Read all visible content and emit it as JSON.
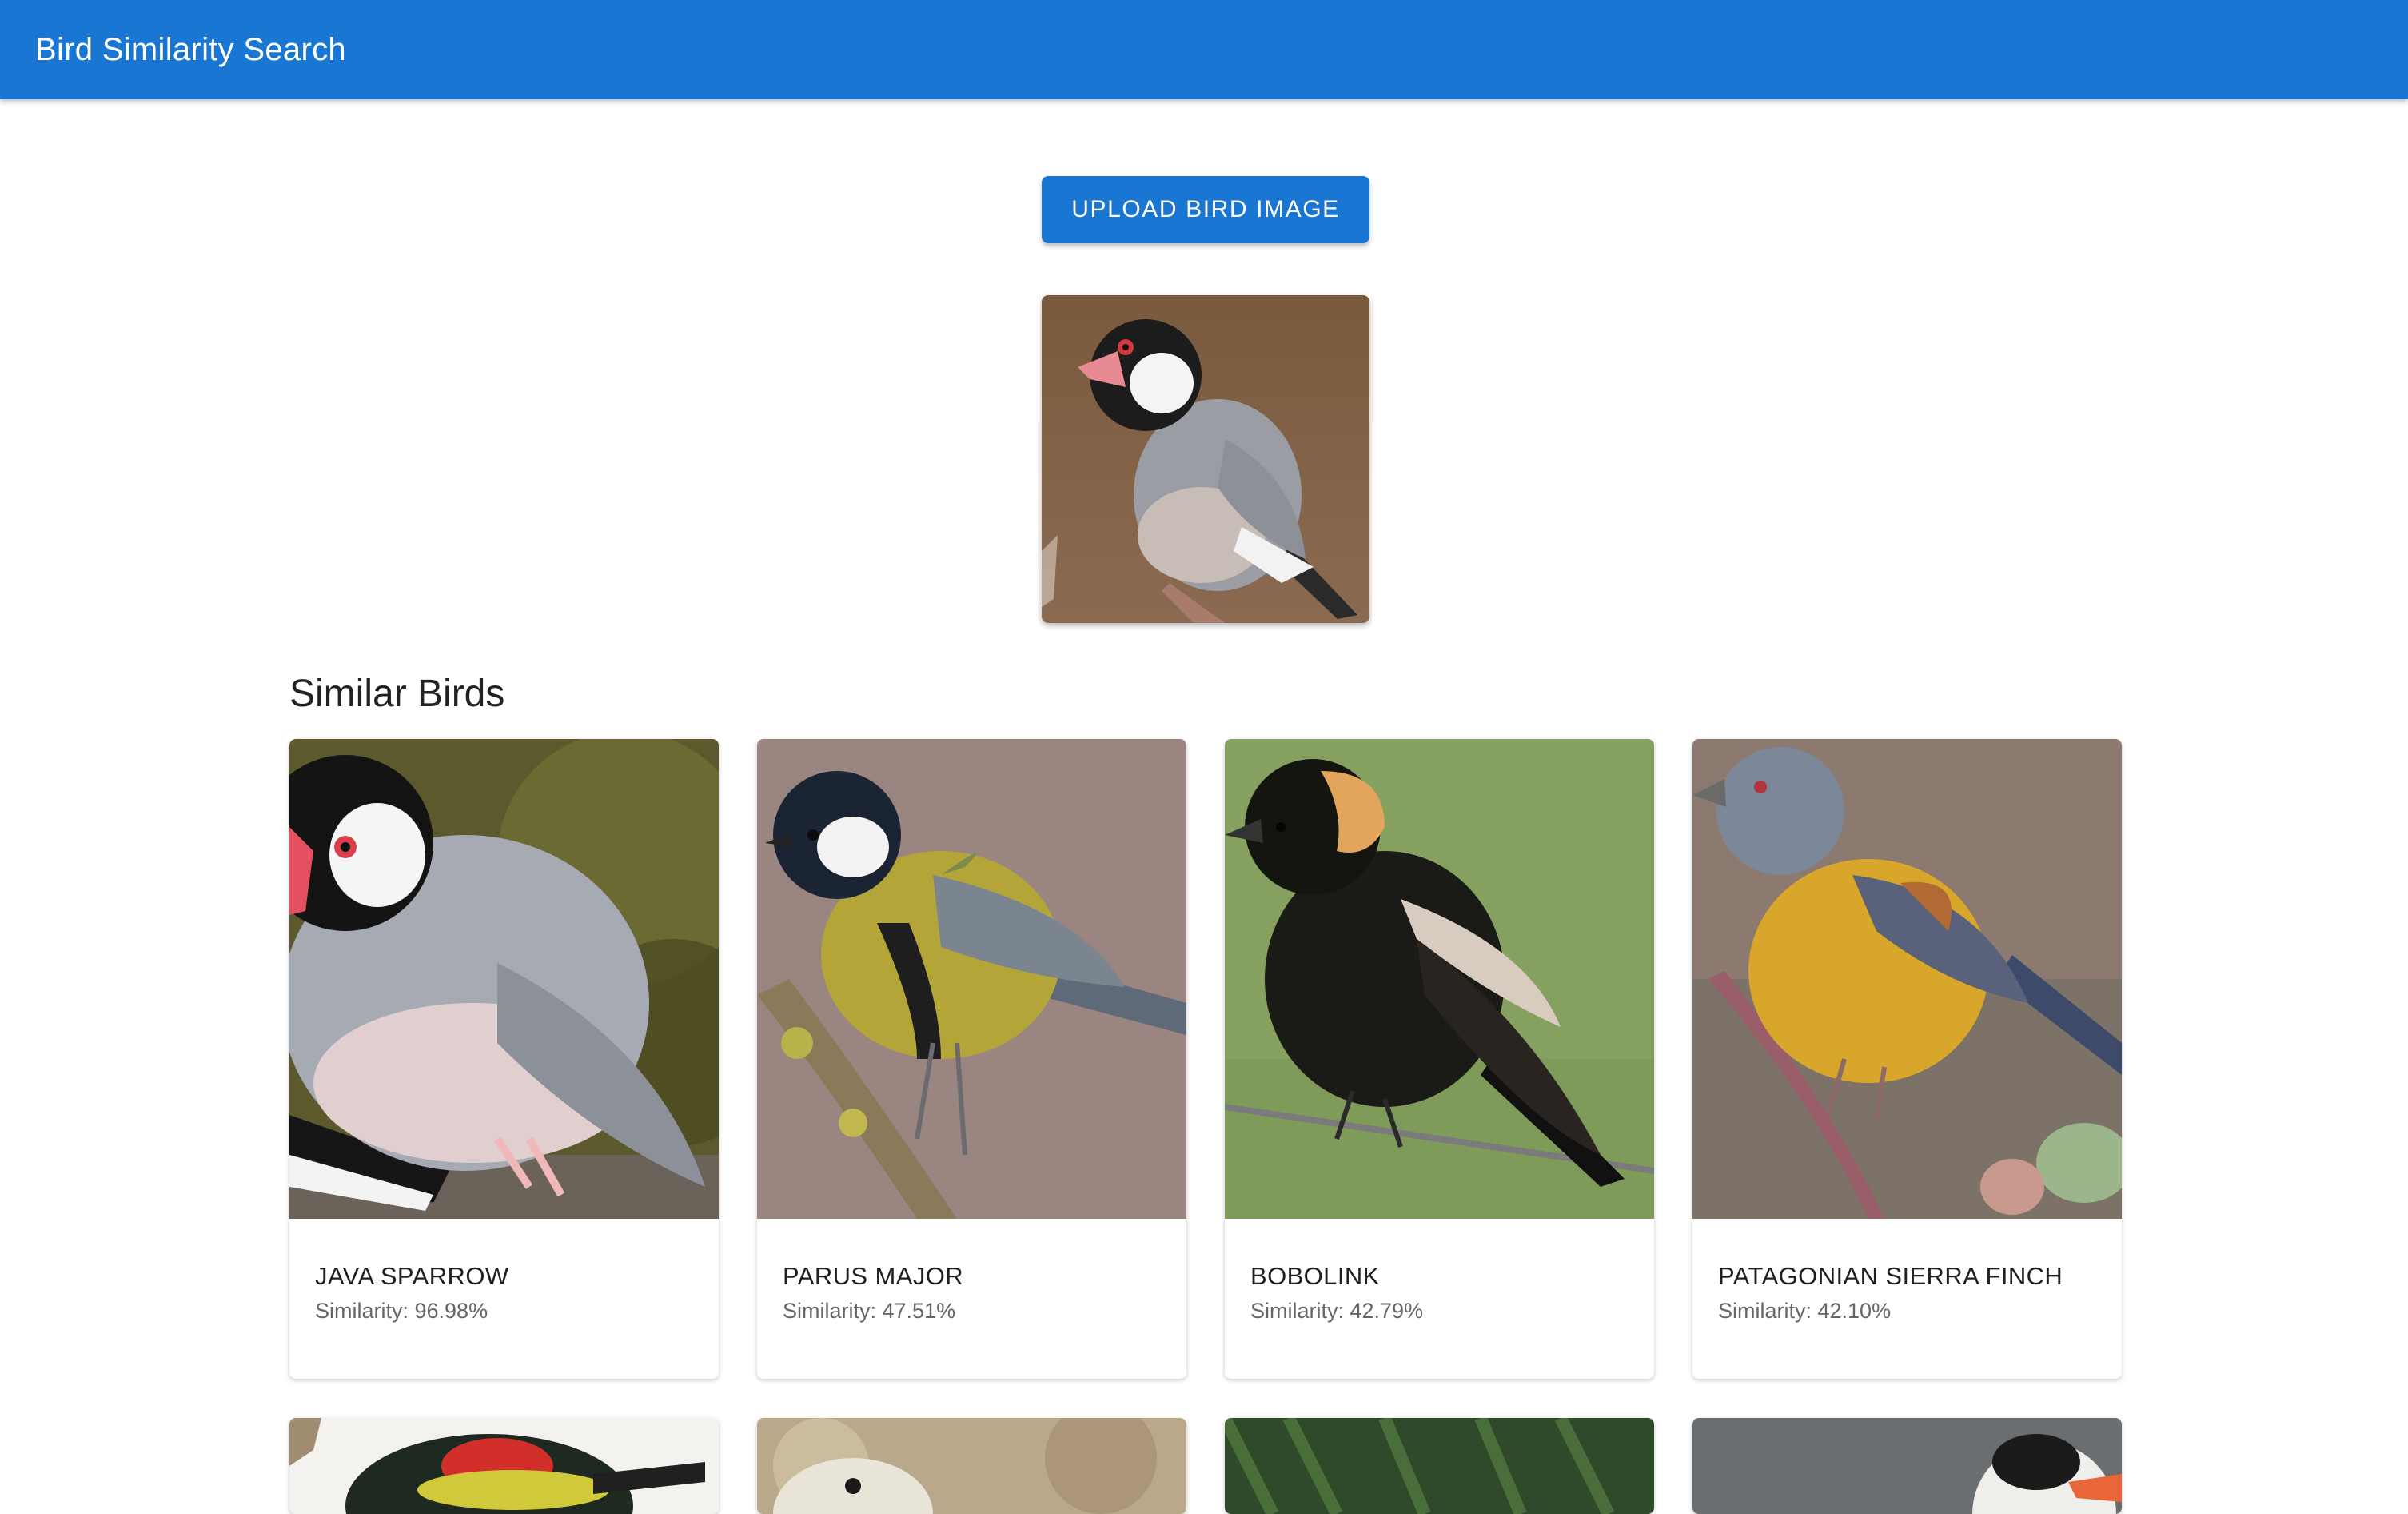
{
  "appbar": {
    "title": "Bird Similarity Search",
    "color": "#1976d2"
  },
  "upload": {
    "label": "UPLOAD BIRD IMAGE"
  },
  "query_image": {
    "alt_icon": "bird-photo"
  },
  "results": {
    "title": "Similar Birds",
    "items": [
      {
        "name": "JAVA SPARROW",
        "similarity": "Similarity: 96.98%"
      },
      {
        "name": "PARUS MAJOR",
        "similarity": "Similarity: 47.51%"
      },
      {
        "name": "BOBOLINK",
        "similarity": "Similarity: 42.79%"
      },
      {
        "name": "PATAGONIAN SIERRA FINCH",
        "similarity": "Similarity: 42.10%"
      }
    ]
  }
}
